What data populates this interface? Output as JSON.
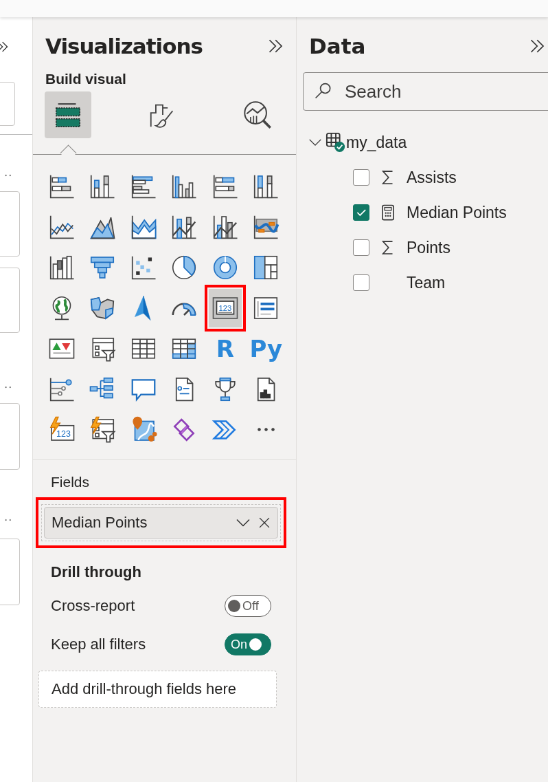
{
  "visualizations": {
    "title": "Visualizations",
    "subtitle": "Build visual",
    "pane_tabs": [
      {
        "kind": "build",
        "selected": true
      },
      {
        "kind": "format",
        "selected": false
      },
      {
        "kind": "analytics",
        "selected": false
      }
    ],
    "visual_types": [
      {
        "kind": "stacked-bar",
        "selected": false,
        "highlighted": false
      },
      {
        "kind": "stacked-column",
        "selected": false,
        "highlighted": false
      },
      {
        "kind": "clustered-bar",
        "selected": false,
        "highlighted": false
      },
      {
        "kind": "clustered-column",
        "selected": false,
        "highlighted": false
      },
      {
        "kind": "percent-bar",
        "selected": false,
        "highlighted": false
      },
      {
        "kind": "percent-column",
        "selected": false,
        "highlighted": false
      },
      {
        "kind": "line",
        "selected": false,
        "highlighted": false
      },
      {
        "kind": "area",
        "selected": false,
        "highlighted": false
      },
      {
        "kind": "stacked-area",
        "selected": false,
        "highlighted": false
      },
      {
        "kind": "line-stacked-column",
        "selected": false,
        "highlighted": false
      },
      {
        "kind": "line-clustered-column",
        "selected": false,
        "highlighted": false
      },
      {
        "kind": "ribbon",
        "selected": false,
        "highlighted": false
      },
      {
        "kind": "waterfall",
        "selected": false,
        "highlighted": false
      },
      {
        "kind": "funnel",
        "selected": false,
        "highlighted": false
      },
      {
        "kind": "scatter",
        "selected": false,
        "highlighted": false
      },
      {
        "kind": "pie",
        "selected": false,
        "highlighted": false
      },
      {
        "kind": "donut",
        "selected": false,
        "highlighted": false
      },
      {
        "kind": "treemap",
        "selected": false,
        "highlighted": false
      },
      {
        "kind": "globe",
        "selected": false,
        "highlighted": false
      },
      {
        "kind": "filled-map",
        "selected": false,
        "highlighted": false
      },
      {
        "kind": "arrow-map",
        "selected": false,
        "highlighted": false
      },
      {
        "kind": "gauge",
        "selected": false,
        "highlighted": false
      },
      {
        "kind": "card",
        "text": "123",
        "selected": true,
        "highlighted": true
      },
      {
        "kind": "multi-row-card",
        "selected": false,
        "highlighted": false
      },
      {
        "kind": "kpi",
        "selected": false,
        "highlighted": false
      },
      {
        "kind": "slicer",
        "selected": false,
        "highlighted": false
      },
      {
        "kind": "table",
        "selected": false,
        "highlighted": false
      },
      {
        "kind": "matrix",
        "selected": false,
        "highlighted": false
      },
      {
        "kind": "letter",
        "text": "R",
        "selected": false,
        "highlighted": false
      },
      {
        "kind": "letter",
        "text": "Py",
        "selected": false,
        "highlighted": false
      },
      {
        "kind": "key-influencers",
        "selected": false,
        "highlighted": false
      },
      {
        "kind": "decomposition-tree",
        "selected": false,
        "highlighted": false
      },
      {
        "kind": "speech-bubble",
        "selected": false,
        "highlighted": false
      },
      {
        "kind": "narrative",
        "selected": false,
        "highlighted": false
      },
      {
        "kind": "trophy",
        "selected": false,
        "highlighted": false
      },
      {
        "kind": "paginated",
        "selected": false,
        "highlighted": false
      },
      {
        "kind": "card-new",
        "text": "123",
        "selected": false,
        "highlighted": false
      },
      {
        "kind": "slicer-new",
        "selected": false,
        "highlighted": false
      },
      {
        "kind": "pin-map",
        "selected": false,
        "highlighted": false
      },
      {
        "kind": "diamonds",
        "selected": false,
        "highlighted": false
      },
      {
        "kind": "chevron-flow",
        "selected": false,
        "highlighted": false
      },
      {
        "kind": "more",
        "selected": false,
        "highlighted": false
      }
    ],
    "fields": {
      "label": "Fields",
      "highlighted": true,
      "items": [
        {
          "name": "Median Points"
        }
      ]
    },
    "drill_through": {
      "title": "Drill through",
      "toggles": [
        {
          "label": "Cross-report",
          "on": false,
          "state_text": "Off"
        },
        {
          "label": "Keep all filters",
          "on": true,
          "state_text": "On"
        }
      ],
      "drop_placeholder": "Add drill-through fields here"
    }
  },
  "data": {
    "title": "Data",
    "search": {
      "placeholder": "Search"
    },
    "tables": [
      {
        "name": "my_data",
        "expanded": true,
        "fields": [
          {
            "name": "Assists",
            "checked": false,
            "kind": "sum"
          },
          {
            "name": "Median Points",
            "checked": true,
            "kind": "measure"
          },
          {
            "name": "Points",
            "checked": false,
            "kind": "sum"
          },
          {
            "name": "Team",
            "checked": false,
            "kind": "text"
          }
        ]
      }
    ]
  }
}
